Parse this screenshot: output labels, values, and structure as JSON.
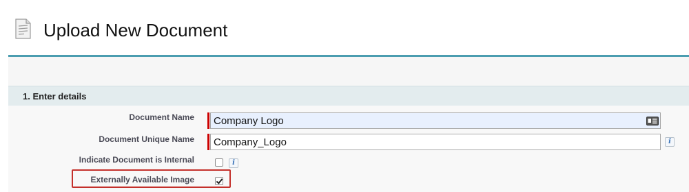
{
  "header": {
    "title": "Upload New Document",
    "icon": "document-icon"
  },
  "section": {
    "title": "1. Enter details"
  },
  "fields": {
    "document_name": {
      "label": "Document Name",
      "value": "Company Logo",
      "required": true,
      "icon": "contact-card-icon"
    },
    "document_unique_name": {
      "label": "Document Unique Name",
      "value": "Company_Logo",
      "required": true,
      "info_icon": "i"
    },
    "indicate_internal": {
      "label": "Indicate Document is Internal",
      "checked": false,
      "info_icon": "i"
    },
    "externally_available": {
      "label": "Externally Available Image",
      "checked": true
    }
  },
  "colors": {
    "accent": "#4b9db0",
    "required": "#cc0000",
    "highlight": "#c4302b",
    "section_bg": "#e3ecee"
  }
}
